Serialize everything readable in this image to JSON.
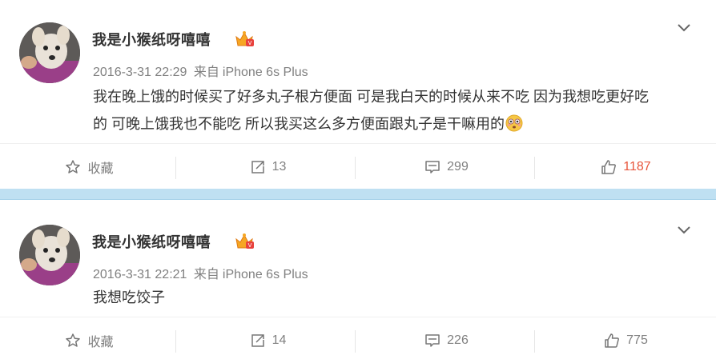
{
  "posts": [
    {
      "username": "我是小猴纸呀嘻嘻",
      "time": "2016-3-31 22:29",
      "source_prefix": "来自",
      "source": "iPhone 6s Plus",
      "text": "我在晚上饿的时候买了好多丸子根方便面 可是我白天的时候从来不吃 因为我想吃更好吃的 可晚上饿我也不能吃 所以我买这么多方便面跟丸子是干嘛用的",
      "emoji": "flushed-emoji",
      "actions": {
        "favorite": "收藏",
        "repost": "13",
        "comment": "299",
        "like": "1187"
      },
      "liked": true
    },
    {
      "username": "我是小猴纸呀嘻嘻",
      "time": "2016-3-31 22:21",
      "source_prefix": "来自",
      "source": "iPhone 6s Plus",
      "text": "我想吃饺子",
      "actions": {
        "favorite": "收藏",
        "repost": "14",
        "comment": "226",
        "like": "775"
      },
      "liked": false
    }
  ],
  "colors": {
    "accent_like": "#e8563c",
    "separator": "#bfe0f2",
    "meta": "#808080"
  },
  "icons": [
    "dropdown-chevron-icon",
    "star-icon",
    "repost-icon",
    "comment-icon",
    "thumbs-up-icon",
    "vip-crown-badge-icon"
  ]
}
